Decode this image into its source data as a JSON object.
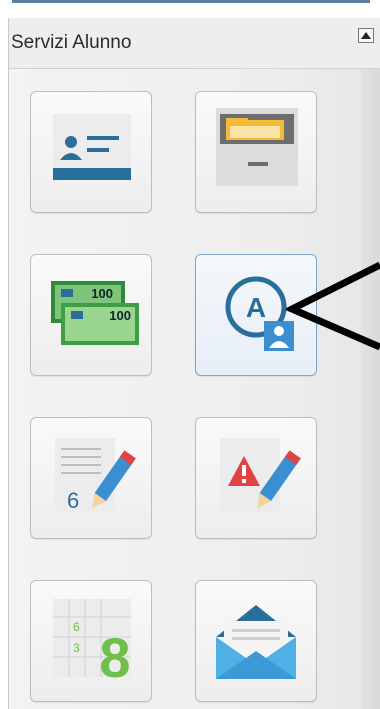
{
  "panel": {
    "title": "Servizi Alunno"
  },
  "icons": {
    "tile1": "student-id-card-icon",
    "tile2": "file-cabinet-icon",
    "tile3": "banknotes-icon",
    "tile4": "attendance-icon",
    "tile5": "written-grade-icon",
    "tile6": "disciplinary-note-icon",
    "tile7": "grades-table-icon",
    "tile8": "messages-envelope-icon"
  },
  "icon_text": {
    "banknote_value_back": "100",
    "banknote_value_front": "100",
    "attendance_letter": "A",
    "written_grade_value": "6",
    "grid_value_top": "6",
    "grid_value_mid": "3",
    "grid_value_big": "8"
  },
  "colors": {
    "accent_blue": "#2a6f9b",
    "header_bar": "#5b7fa3",
    "green": "#6fbf4a",
    "red": "#e04343"
  }
}
